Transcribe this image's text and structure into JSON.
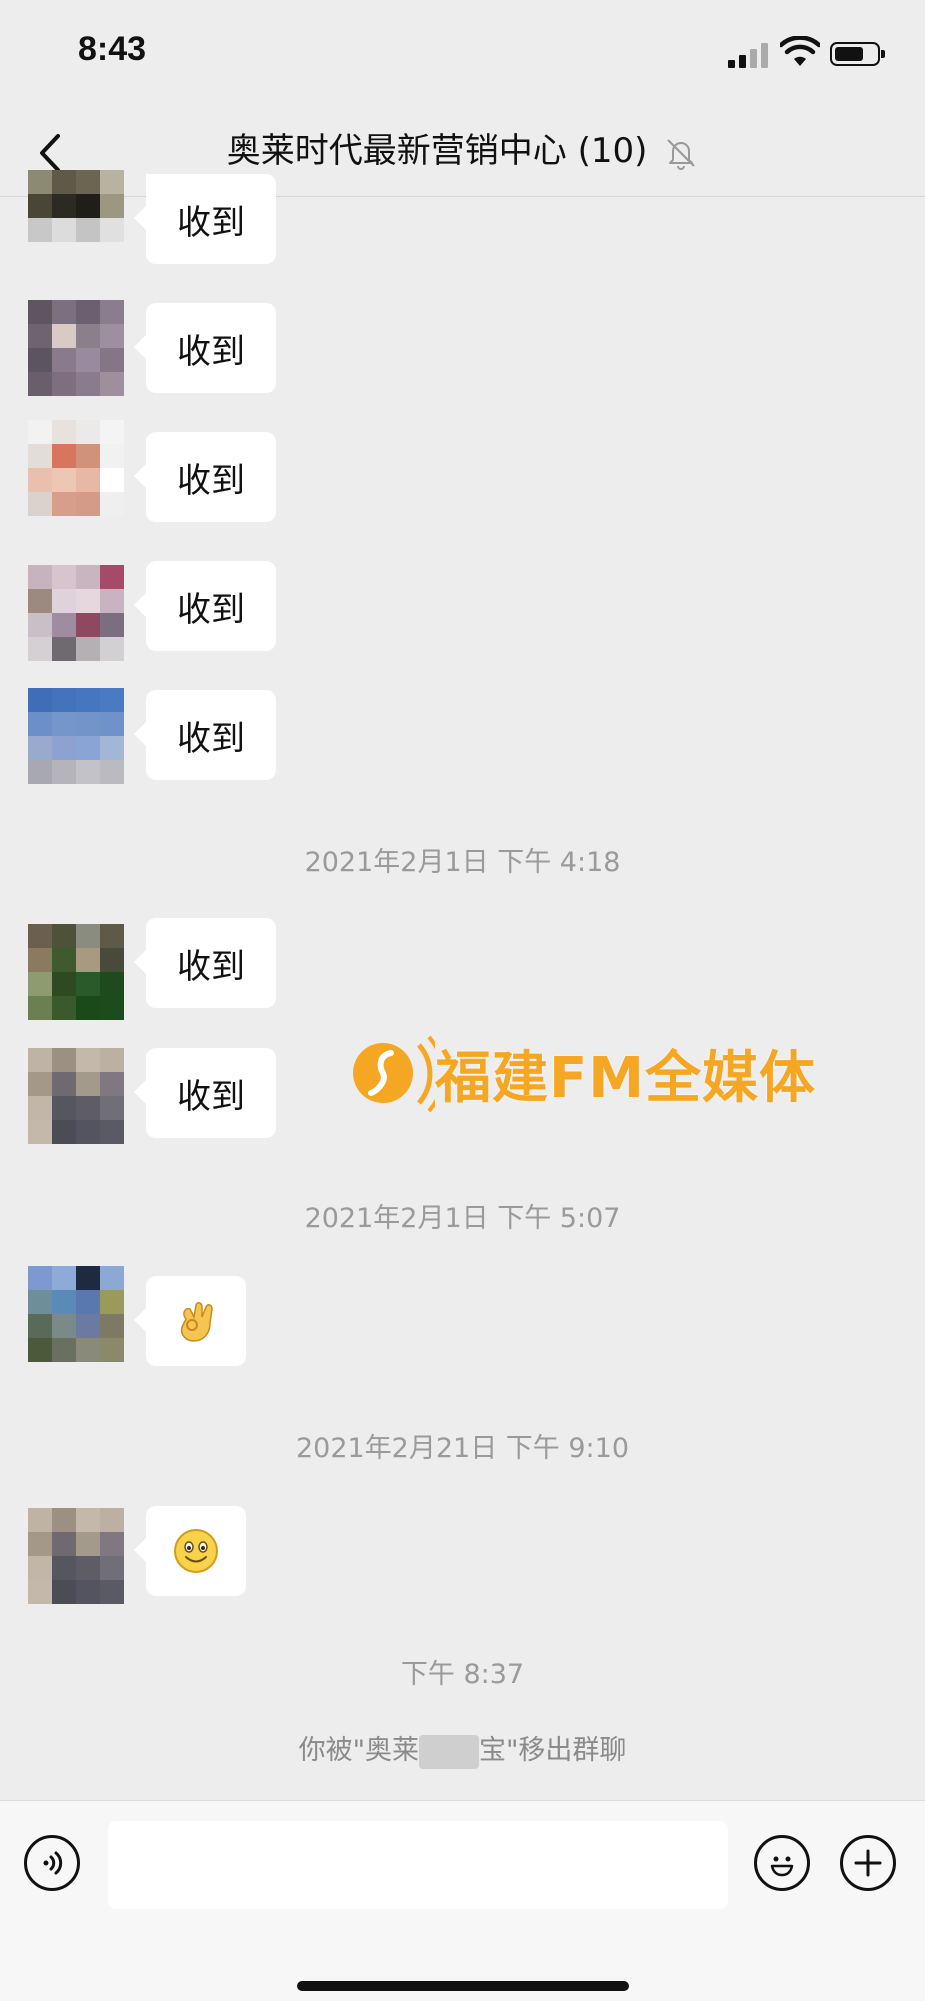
{
  "status": {
    "time": "8:43"
  },
  "header": {
    "title": "奥莱时代最新营销中心 (10)"
  },
  "messages": [
    {
      "text": "收到"
    },
    {
      "text": "收到"
    },
    {
      "text": "收到"
    },
    {
      "text": "收到"
    },
    {
      "text": "收到"
    },
    {
      "text": "收到"
    },
    {
      "text": "收到"
    }
  ],
  "timestamps": [
    "2021年2月1日 下午 4:18",
    "2021年2月1日 下午 5:07",
    "2021年2月21日 下午 9:10",
    "下午 8:37"
  ],
  "system_message": {
    "prefix": "你被\"奥莱",
    "suffix": "宝\"移出群聊"
  },
  "watermark": {
    "text": "福建FM全媒体"
  },
  "colors": {
    "background": "#ededed",
    "bubble": "#ffffff",
    "watermark": "#f5a623"
  },
  "icons": [
    "back-chevron-icon",
    "mute-bell-icon",
    "voice-icon",
    "emoji-icon",
    "plus-icon"
  ]
}
